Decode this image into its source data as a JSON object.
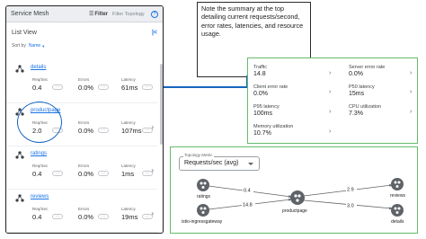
{
  "mesh": {
    "title": "Service Mesh",
    "filter_label": "Filter",
    "filter_placeholder": "Filter Topology",
    "list_view": "List View",
    "sort_by_label": "Sort by",
    "sort_by_value": "Name",
    "metric_labels": {
      "rps": "Req/Sec",
      "errors": "Errors",
      "latency": "Latency"
    },
    "more": "···",
    "services": [
      {
        "name": "details",
        "rps": "0.4",
        "errors": "0.0%",
        "latency": "61ms"
      },
      {
        "name": "productpage",
        "rps": "2.0",
        "errors": "0.0%",
        "latency": "107ms"
      },
      {
        "name": "ratings",
        "rps": "0.4",
        "errors": "0.0%",
        "latency": "1ms"
      },
      {
        "name": "reviews",
        "rps": "0.4",
        "errors": "0.0%",
        "latency": "19ms"
      }
    ]
  },
  "note": {
    "text": "Note the summary at the top detailing current requests/second, error rates, latencies, and resource usage."
  },
  "summary": {
    "traffic": {
      "label": "Traffic",
      "value": "14.8"
    },
    "server_error_rate": {
      "label": "Server error rate",
      "value": "0.0%"
    },
    "client_error_rate": {
      "label": "Client error rate",
      "value": "0.0%"
    },
    "p50_latency": {
      "label": "P50 latency",
      "value": "15ms"
    },
    "p95_latency": {
      "label": "P95 latency",
      "value": "100ms"
    },
    "cpu_utilization": {
      "label": "CPU utilization",
      "value": "7.3%"
    },
    "memory_utilization": {
      "label": "Memory utilization",
      "value": "10.7%"
    }
  },
  "topology": {
    "metric_legend": "Topology Metric",
    "metric_value": "Requests/sec (avg)",
    "nodes": {
      "ratings": "ratings",
      "ingress": "istio-ingressgateway",
      "productpage": "productpage",
      "reviews": "reviews",
      "details": "details"
    },
    "edges": {
      "ratings_productpage": "0.4",
      "ingress_productpage": "14.8",
      "productpage_reviews": "2.9",
      "productpage_details": "3.0"
    }
  },
  "colors": {
    "accent": "#1a73e8",
    "highlight": "#1565c0",
    "green_border": "#66bb6a"
  }
}
